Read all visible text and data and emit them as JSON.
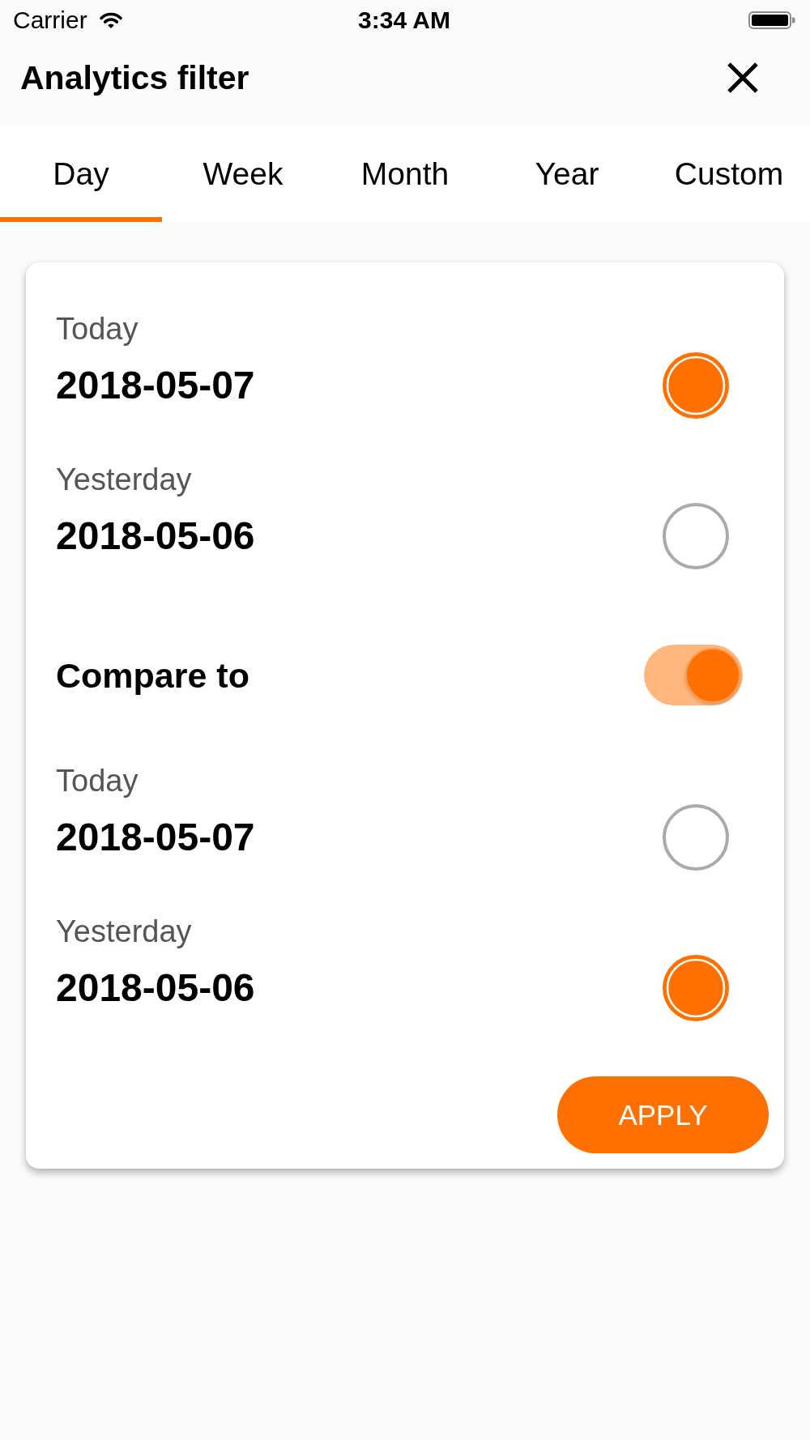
{
  "status_bar": {
    "carrier": "Carrier",
    "time": "3:34 AM"
  },
  "header": {
    "title": "Analytics filter"
  },
  "tabs": [
    {
      "label": "Day",
      "selected": true
    },
    {
      "label": "Week",
      "selected": false
    },
    {
      "label": "Month",
      "selected": false
    },
    {
      "label": "Year",
      "selected": false
    },
    {
      "label": "Custom",
      "selected": false
    }
  ],
  "filter_card": {
    "periods": [
      {
        "label": "Today",
        "date": "2018-05-07",
        "selected": true
      },
      {
        "label": "Yesterday",
        "date": "2018-05-06",
        "selected": false
      }
    ],
    "compare": {
      "label": "Compare to",
      "on": true
    },
    "compare_periods": [
      {
        "label": "Today",
        "date": "2018-05-07",
        "selected": false
      },
      {
        "label": "Yesterday",
        "date": "2018-05-06",
        "selected": true
      }
    ],
    "apply_button": {
      "label": "APPLY"
    }
  }
}
